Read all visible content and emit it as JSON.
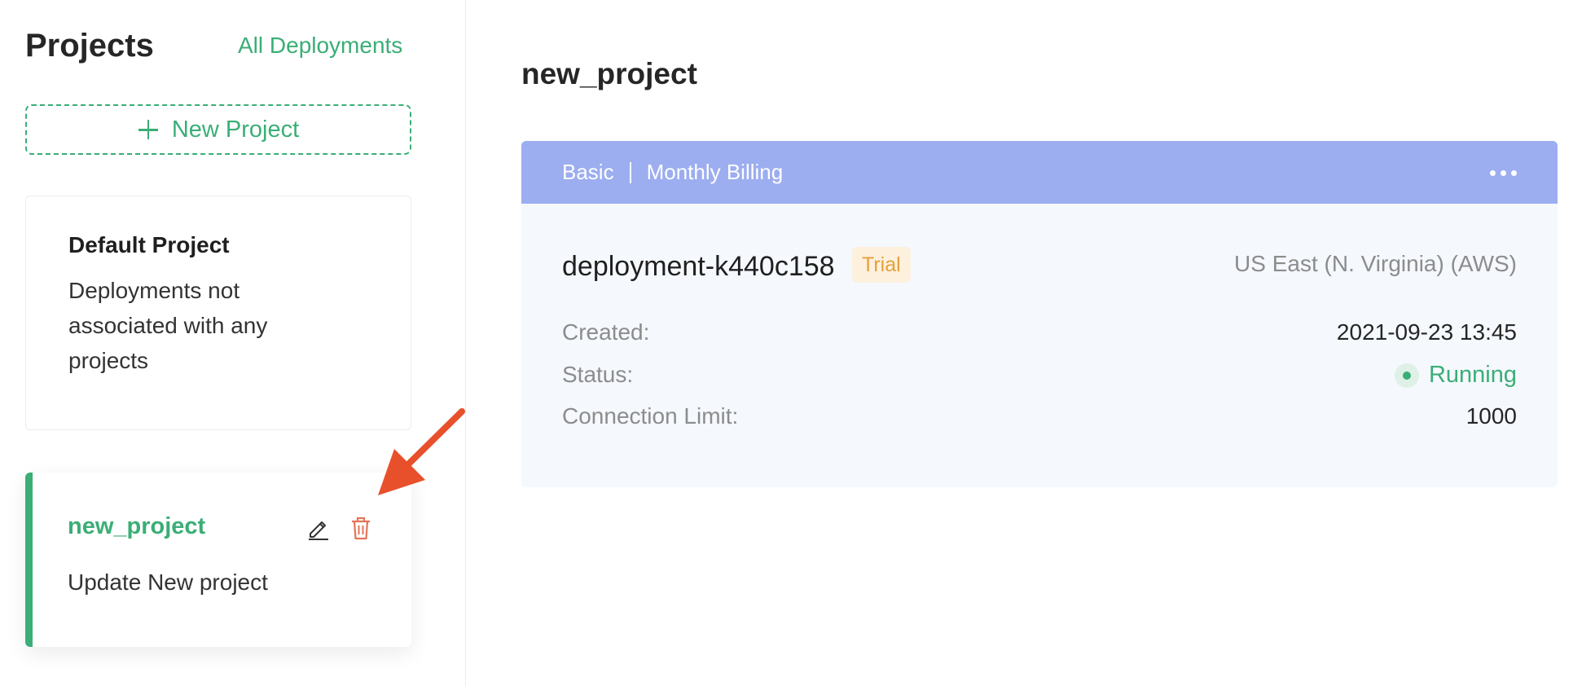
{
  "sidebar": {
    "title": "Projects",
    "all_deployments_label": "All Deployments",
    "new_project_label": "New Project",
    "projects": [
      {
        "name": "Default Project",
        "description": "Deployments not associated with any projects"
      },
      {
        "name": "new_project",
        "description": "Update New project",
        "selected": true
      }
    ]
  },
  "main": {
    "title": "new_project",
    "deployment": {
      "plan": "Basic",
      "billing": "Monthly Billing",
      "name": "deployment-k440c158",
      "badge": "Trial",
      "region": "US East (N. Virginia) (AWS)",
      "created_label": "Created:",
      "created_value": "2021-09-23 13:45",
      "status_label": "Status:",
      "status_value": "Running",
      "connection_limit_label": "Connection Limit:",
      "connection_limit_value": "1000"
    }
  },
  "colors": {
    "accent_green": "#3aae76",
    "header_blue": "#9cadf0",
    "trial_orange": "#e3a13a",
    "delete_orange": "#e5745a",
    "annotation_arrow": "#e8502c"
  },
  "icons": [
    "plus-icon",
    "edit-icon",
    "trash-icon",
    "more-icon",
    "status-dot-icon"
  ]
}
